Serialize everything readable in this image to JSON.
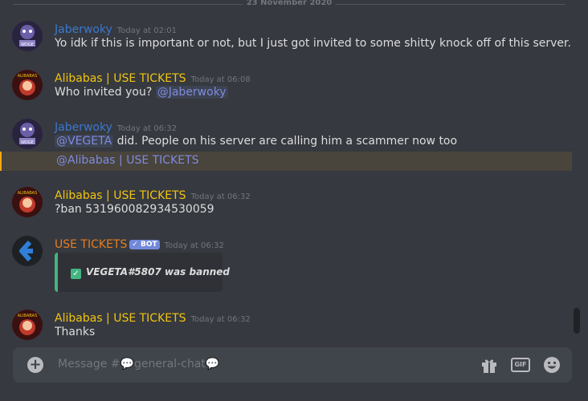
{
  "date_divider": "23 November 2020",
  "messages": [
    {
      "username": "Jaberwoky",
      "timestamp": "Today at 02:01",
      "text": "Yo idk if this is important or not, but I just got invited to some shitty knock off of this server."
    },
    {
      "username": "Alibabas | USE TICKETS",
      "timestamp": "Today at 06:08",
      "text": "Who invited you?",
      "mention": "@Jaberwoky"
    },
    {
      "username": "Jaberwoky",
      "timestamp": "Today at 06:32",
      "mention": "@VEGETA",
      "text": " did. People on his server are calling him a scammer now too",
      "mention2": "@Alibabas | USE TICKETS"
    },
    {
      "username": "Alibabas | USE TICKETS",
      "timestamp": "Today at 06:32",
      "text": "?ban 531960082934530059"
    },
    {
      "username": "USE TICKETS",
      "bot_tag": "BOT",
      "timestamp": "Today at 06:32",
      "embed_text": "VEGETA#5807 was banned"
    },
    {
      "username": "Alibabas | USE TICKETS",
      "timestamp": "Today at 06:32",
      "text": "Thanks"
    }
  ],
  "composer": {
    "placeholder_prefix": "Message #",
    "channel": "general-chat",
    "gif_label": "GIF"
  },
  "colors": {
    "background": "#36393f",
    "username_blue": "#3b78d0",
    "username_yellow": "#f1c40f",
    "username_orange": "#e67e22",
    "mention": "#7e8bde",
    "embed_accent": "#43b581",
    "highlight_border": "#faa61a"
  }
}
